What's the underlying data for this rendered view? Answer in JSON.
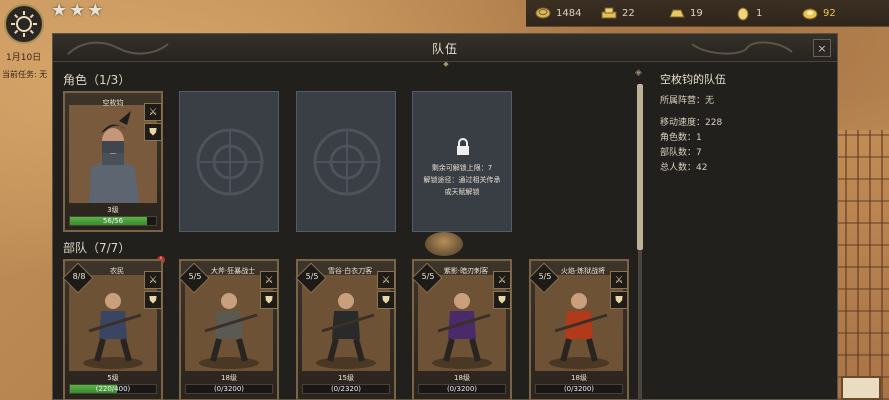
{
  "hud": {
    "date": "1月10日",
    "current_task": "当前任务: 无",
    "star_count": 3,
    "star_glyph": "★"
  },
  "resources": [
    {
      "icon": "coin-stack-icon",
      "value": "1484"
    },
    {
      "icon": "gold-bars-icon",
      "value": "22"
    },
    {
      "icon": "gold-ingot-icon",
      "value": "19"
    },
    {
      "icon": "gold-nugget-icon",
      "value": "1"
    },
    {
      "icon": "gold-coin-pouch-icon",
      "value": "92"
    }
  ],
  "panel": {
    "title": "队伍",
    "close_label": "×"
  },
  "characters": {
    "title": "角色（1/3）",
    "card": {
      "name": "空枚钧",
      "level": "3级",
      "hp_text": "56/56",
      "hp_fraction": 0.9
    },
    "locked_slot": {
      "line1": "剩余可解锁上限：7",
      "line2": "解锁途径：通过相关传承",
      "line3": "或天赋解锁"
    }
  },
  "troops": {
    "title": "部队（7/7）",
    "cards": [
      {
        "count": "8/8",
        "name": "农民",
        "level": "5级",
        "xp": "(220/400)",
        "xp_fraction": 0.55,
        "color": "#3a4566"
      },
      {
        "count": "5/5",
        "name": "大斧·狂暴战士",
        "level": "18级",
        "xp": "(0/3200)",
        "xp_fraction": 0,
        "color": "#5a5a52"
      },
      {
        "count": "5/5",
        "name": "雪谷·白衣刀客",
        "level": "15级",
        "xp": "(0/2320)",
        "xp_fraction": 0,
        "color": "#2a2a2a"
      },
      {
        "count": "5/5",
        "name": "紫影·暗刃刺客",
        "level": "18级",
        "xp": "(0/3200)",
        "xp_fraction": 0,
        "color": "#4a2a6a"
      },
      {
        "count": "5/5",
        "name": "火焰·炼狱战将",
        "level": "18级",
        "xp": "(0/3200)",
        "xp_fraction": 0,
        "color": "#b03a1a"
      }
    ]
  },
  "info": {
    "title": "空枚钧的队伍",
    "faction": "所属阵营：无",
    "move_speed": "移动速度：228",
    "role_count": "角色数：1",
    "troop_count": "部队数：7",
    "total_count": "总人数：42"
  },
  "colors": {
    "panel_bg": "#22201d",
    "card_border": "#7a6446",
    "xp_green": "#58b544",
    "badge_red": "#d0262a"
  }
}
